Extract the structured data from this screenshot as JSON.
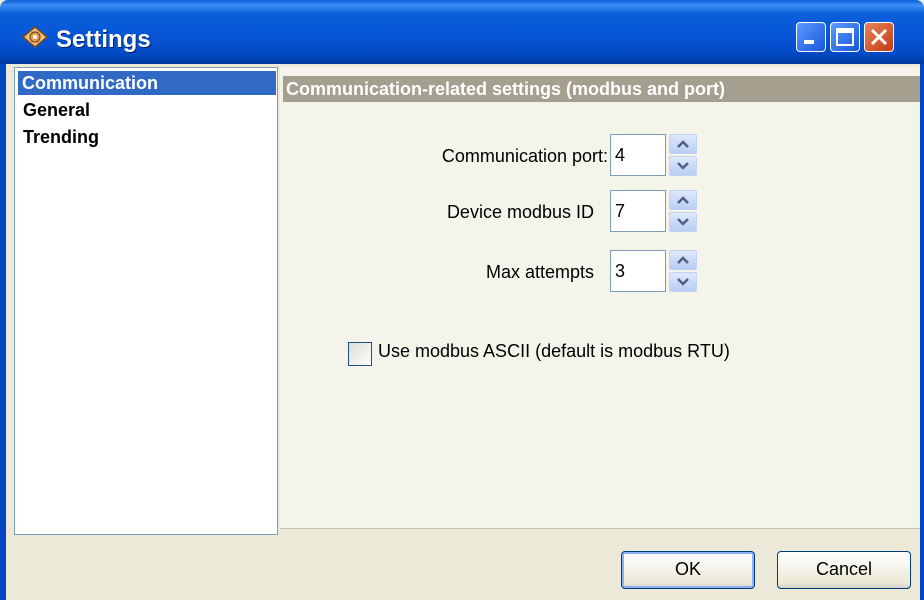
{
  "window": {
    "title": "Settings",
    "icon": "settings-app-icon",
    "controls": [
      "minimize-icon",
      "maximize-icon",
      "close-icon"
    ]
  },
  "nav": {
    "items": [
      {
        "label": "Communication",
        "selected": true
      },
      {
        "label": "General",
        "selected": false
      },
      {
        "label": "Trending",
        "selected": false
      }
    ]
  },
  "panel": {
    "header": "Communication-related settings (modbus and port)",
    "fields": [
      {
        "label": "Communication port:",
        "value": "4"
      },
      {
        "label": "Device modbus ID",
        "value": "7"
      },
      {
        "label": "Max attempts",
        "value": "3"
      }
    ],
    "checkbox": {
      "label": "Use modbus ASCII (default is modbus RTU)",
      "checked": false
    }
  },
  "buttons": {
    "ok": "OK",
    "cancel": "Cancel"
  }
}
